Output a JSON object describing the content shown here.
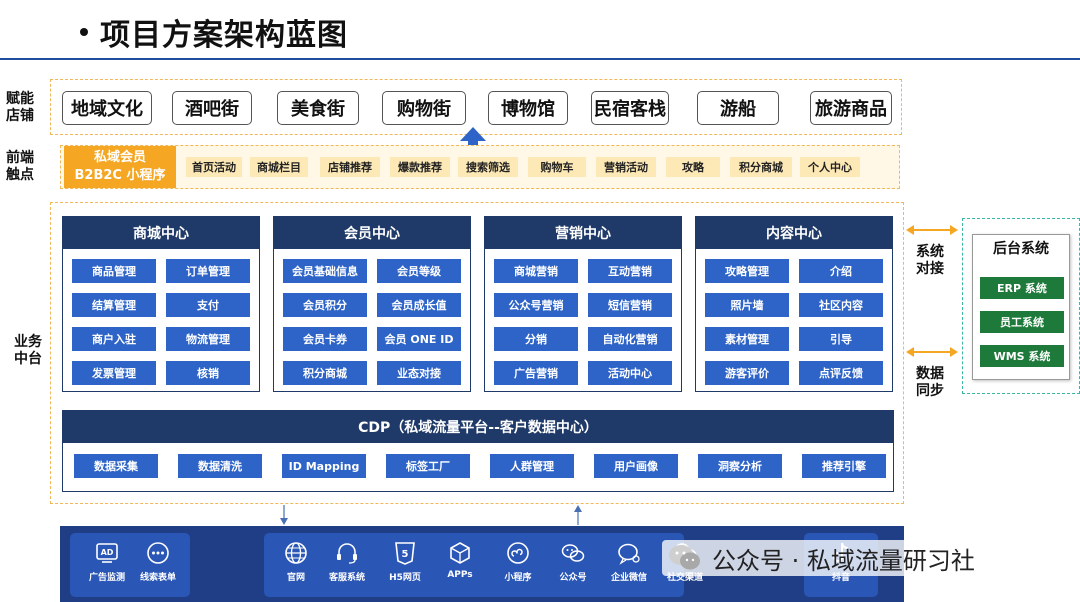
{
  "title": "项目方案架构蓝图",
  "side_labels": {
    "empower": "赋能\n店铺",
    "front": "前端\n触点",
    "business": "业务\n中台",
    "system_dock": "系统\n对接",
    "data_sync": "数据\n同步"
  },
  "shops": [
    "地域文化",
    "酒吧街",
    "美食街",
    "购物街",
    "博物馆",
    "民宿客栈",
    "游船",
    "旅游商品"
  ],
  "miniapp": {
    "line1": "私域会员",
    "line2": "B2B2C 小程序"
  },
  "touchpoints": [
    "首页活动",
    "商城栏目",
    "店铺推荐",
    "爆款推荐",
    "搜索筛选",
    "购物车",
    "营销活动",
    "攻略",
    "积分商城",
    "个人中心"
  ],
  "panels": [
    {
      "title": "商城中心",
      "items": [
        "商品管理",
        "订单管理",
        "结算管理",
        "支付",
        "商户入驻",
        "物流管理",
        "发票管理",
        "核销"
      ]
    },
    {
      "title": "会员中心",
      "items": [
        "会员基础信息",
        "会员等级",
        "会员积分",
        "会员成长值",
        "会员卡券",
        "会员 ONE ID",
        "积分商城",
        "业态对接"
      ]
    },
    {
      "title": "营销中心",
      "items": [
        "商城营销",
        "互动营销",
        "公众号营销",
        "短信营销",
        "分销",
        "自动化营销",
        "广告营销",
        "活动中心"
      ]
    },
    {
      "title": "内容中心",
      "items": [
        "攻略管理",
        "介绍",
        "照片墙",
        "社区内容",
        "素材管理",
        "引导",
        "游客评价",
        "点评反馈"
      ]
    }
  ],
  "cdp": {
    "title": "CDP（私域流量平台--客户数据中心）",
    "items": [
      "数据采集",
      "数据清洗",
      "ID Mapping",
      "标签工厂",
      "人群管理",
      "用户画像",
      "洞察分析",
      "推荐引擎"
    ]
  },
  "backend": {
    "title": "后台系统",
    "items": [
      "ERP 系统",
      "员工系统",
      "WMS 系统"
    ]
  },
  "channels_left": [
    {
      "label": "广告监测",
      "icon": "ad-icon"
    },
    {
      "label": "线索表单",
      "icon": "dots-icon"
    }
  ],
  "channels_main": [
    {
      "label": "官网",
      "icon": "globe-icon"
    },
    {
      "label": "客服系统",
      "icon": "headset-icon"
    },
    {
      "label": "H5网页",
      "icon": "html5-icon"
    },
    {
      "label": "APPs",
      "icon": "cube-icon"
    },
    {
      "label": "小程序",
      "icon": "miniprogram-icon"
    },
    {
      "label": "公众号",
      "icon": "wechat-icon"
    },
    {
      "label": "企业微信",
      "icon": "wecom-icon"
    },
    {
      "label": "社交渠道",
      "icon": "social-icon"
    }
  ],
  "channel_right": {
    "label": "抖音",
    "icon": "douyin-icon"
  },
  "watermark": "公众号 · 私域流量研习社",
  "colors": {
    "navy": "#1f3a68",
    "chip_blue": "#2e64c7",
    "orange": "#f5a623",
    "light_yellow": "#fde9b6",
    "green": "#1e7a3a",
    "teal": "#3bb7a8",
    "bottom_blue": "#1f3e85"
  }
}
